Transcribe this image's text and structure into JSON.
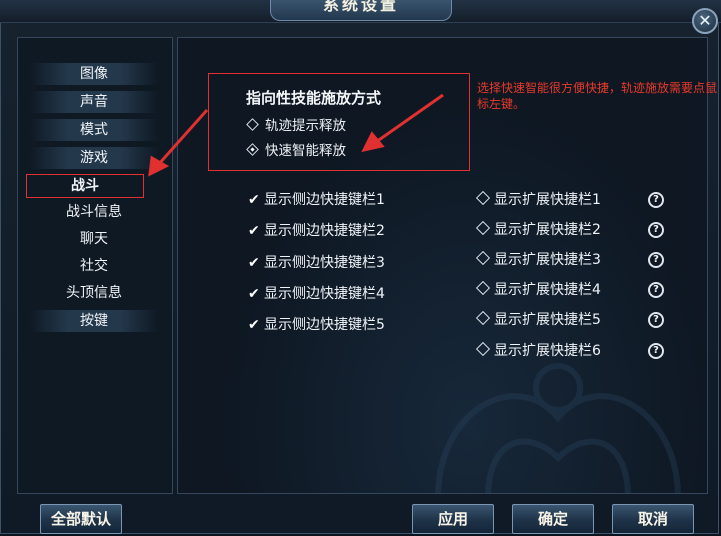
{
  "window": {
    "title": "系统设置",
    "close_label": "✕"
  },
  "sidebar": {
    "items": [
      {
        "label": "图像"
      },
      {
        "label": "声音"
      },
      {
        "label": "模式"
      },
      {
        "label": "游戏"
      },
      {
        "label": "战斗",
        "selected": true
      },
      {
        "label": "战斗信息"
      },
      {
        "label": "聊天"
      },
      {
        "label": "社交"
      },
      {
        "label": "头顶信息"
      },
      {
        "label": "按键"
      }
    ]
  },
  "casting": {
    "title": "指向性技能施放方式",
    "options": [
      {
        "label": "轨迹提示释放",
        "selected": false
      },
      {
        "label": "快速智能释放",
        "selected": true
      }
    ]
  },
  "annotation": {
    "text": "选择快速智能很方便快捷，轨迹施放需要点鼠标左键。",
    "color": "#e83a2a"
  },
  "side_bars": [
    {
      "label": "显示侧边快捷键栏1",
      "checked": true
    },
    {
      "label": "显示侧边快捷键栏2",
      "checked": true
    },
    {
      "label": "显示侧边快捷键栏3",
      "checked": true
    },
    {
      "label": "显示侧边快捷键栏4",
      "checked": true
    },
    {
      "label": "显示侧边快捷键栏5",
      "checked": true
    }
  ],
  "ext_bars": [
    {
      "label": "显示扩展快捷栏1",
      "checked": false
    },
    {
      "label": "显示扩展快捷栏2",
      "checked": false
    },
    {
      "label": "显示扩展快捷栏3",
      "checked": false
    },
    {
      "label": "显示扩展快捷栏4",
      "checked": false
    },
    {
      "label": "显示扩展快捷栏5",
      "checked": false
    },
    {
      "label": "显示扩展快捷栏6",
      "checked": false
    }
  ],
  "help_icon": "?",
  "buttons": {
    "reset_all": "全部默认",
    "apply": "应用",
    "ok": "确定",
    "cancel": "取消"
  },
  "colors": {
    "accent_red": "#e03030",
    "panel_bg": "#0f1924"
  }
}
